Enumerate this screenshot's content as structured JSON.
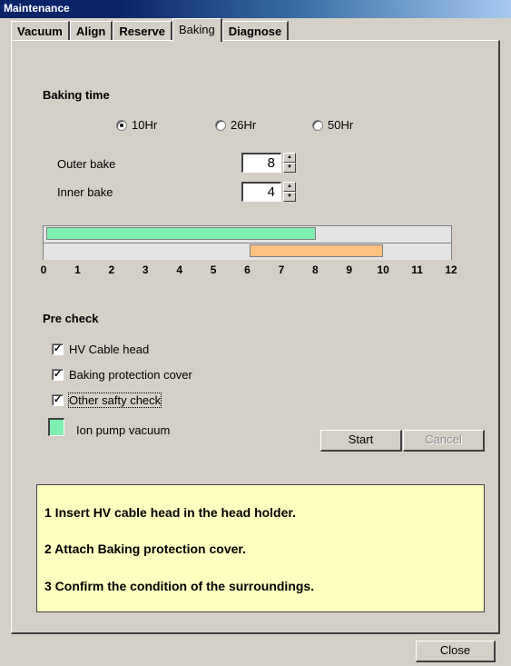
{
  "window": {
    "title": "Maintenance"
  },
  "tabs": [
    {
      "label": "Vacuum",
      "active": false
    },
    {
      "label": "Align",
      "active": false
    },
    {
      "label": "Reserve",
      "active": false
    },
    {
      "label": "Baking",
      "active": true
    },
    {
      "label": "Diagnose",
      "active": false
    }
  ],
  "baking_time": {
    "title": "Baking time",
    "options": [
      {
        "label": "10Hr",
        "selected": true
      },
      {
        "label": "26Hr",
        "selected": false
      },
      {
        "label": "50Hr",
        "selected": false
      }
    ],
    "outer_bake": {
      "label": "Outer bake",
      "value": "8"
    },
    "inner_bake": {
      "label": "Inner bake",
      "value": "4"
    }
  },
  "timeline": {
    "ticks": [
      "0",
      "1",
      "2",
      "3",
      "4",
      "5",
      "6",
      "7",
      "8",
      "9",
      "10",
      "11",
      "12"
    ],
    "axis_max": 12,
    "outer_bar": {
      "start": 0,
      "end": 8,
      "color": "#80f0b0"
    },
    "inner_bar": {
      "start": 6,
      "end": 10,
      "color": "#ffc080"
    }
  },
  "pre_check": {
    "title": "Pre check",
    "items": [
      {
        "label": "HV Cable head",
        "checked": true
      },
      {
        "label": "Baking protection cover",
        "checked": true
      },
      {
        "label": "Other safty check",
        "checked": true
      }
    ],
    "ion_pump": {
      "label": "Ion pump vacuum",
      "color": "#80f0b0"
    }
  },
  "buttons": {
    "start": "Start",
    "cancel": "Cancel",
    "close": "Close"
  },
  "instructions": [
    "1 Insert HV cable head in the head holder.",
    "2 Attach Baking protection cover.",
    "3 Confirm the condition of the surroundings."
  ]
}
